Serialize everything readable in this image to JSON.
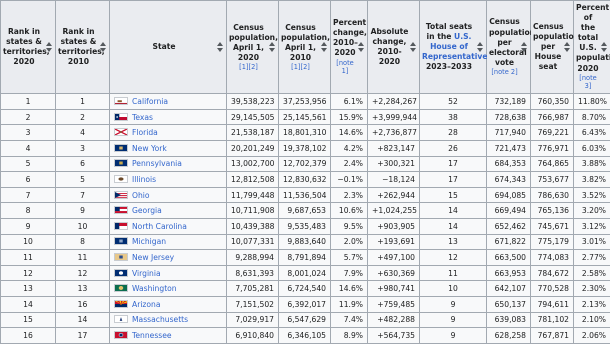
{
  "columns": [
    {
      "label": "Rank in states & territories, 2020"
    },
    {
      "label": "Rank in states & territories, 2010"
    },
    {
      "label": "State"
    },
    {
      "label": "Census population, April 1, 2020",
      "note": "[1][2]"
    },
    {
      "label": "Census population, April 1, 2010",
      "note": "[1][2]"
    },
    {
      "label": "Percent change, 2010–2020",
      "note": "[note 1]"
    },
    {
      "label": "Absolute change, 2010-2020"
    },
    {
      "label_pre": "Total seats in the ",
      "link": "U.S. House of Representatives",
      "label_post": ", 2023–2033"
    },
    {
      "label": "Census population per electoral vote",
      "note": "[note 2]"
    },
    {
      "label": "Census population per House seat"
    },
    {
      "label": "Percent of the total U.S. population, 2020",
      "note": "[note 3]"
    }
  ],
  "rows": [
    {
      "rank2020": "1",
      "rank2010": "1",
      "state": "California",
      "flag": "california-flag-icon",
      "pop2020": "39,538,223",
      "pop2010": "37,253,956",
      "pct_change": "6.1%",
      "abs_change": "+2,284,267",
      "seats": "52",
      "per_ev": "732,189",
      "per_seat": "760,350",
      "pct_total": "11.80%"
    },
    {
      "rank2020": "2",
      "rank2010": "2",
      "state": "Texas",
      "flag": "texas-flag-icon",
      "pop2020": "29,145,505",
      "pop2010": "25,145,561",
      "pct_change": "15.9%",
      "abs_change": "+3,999,944",
      "seats": "38",
      "per_ev": "728,638",
      "per_seat": "766,987",
      "pct_total": "8.70%"
    },
    {
      "rank2020": "3",
      "rank2010": "4",
      "state": "Florida",
      "flag": "florida-flag-icon",
      "pop2020": "21,538,187",
      "pop2010": "18,801,310",
      "pct_change": "14.6%",
      "abs_change": "+2,736,877",
      "seats": "28",
      "per_ev": "717,940",
      "per_seat": "769,221",
      "pct_total": "6.43%"
    },
    {
      "rank2020": "4",
      "rank2010": "3",
      "state": "New York",
      "flag": "new-york-flag-icon",
      "pop2020": "20,201,249",
      "pop2010": "19,378,102",
      "pct_change": "4.2%",
      "abs_change": "+823,147",
      "seats": "26",
      "per_ev": "721,473",
      "per_seat": "776,971",
      "pct_total": "6.03%"
    },
    {
      "rank2020": "5",
      "rank2010": "6",
      "state": "Pennsylvania",
      "flag": "pennsylvania-flag-icon",
      "pop2020": "13,002,700",
      "pop2010": "12,702,379",
      "pct_change": "2.4%",
      "abs_change": "+300,321",
      "seats": "17",
      "per_ev": "684,353",
      "per_seat": "764,865",
      "pct_total": "3.88%"
    },
    {
      "rank2020": "6",
      "rank2010": "5",
      "state": "Illinois",
      "flag": "illinois-flag-icon",
      "pop2020": "12,812,508",
      "pop2010": "12,830,632",
      "pct_change": "−0.1%",
      "abs_change": "−18,124",
      "seats": "17",
      "per_ev": "674,343",
      "per_seat": "753,677",
      "pct_total": "3.82%"
    },
    {
      "rank2020": "7",
      "rank2010": "7",
      "state": "Ohio",
      "flag": "ohio-flag-icon",
      "pop2020": "11,799,448",
      "pop2010": "11,536,504",
      "pct_change": "2.3%",
      "abs_change": "+262,944",
      "seats": "15",
      "per_ev": "694,085",
      "per_seat": "786,630",
      "pct_total": "3.52%"
    },
    {
      "rank2020": "8",
      "rank2010": "9",
      "state": "Georgia",
      "flag": "georgia-flag-icon",
      "pop2020": "10,711,908",
      "pop2010": "9,687,653",
      "pct_change": "10.6%",
      "abs_change": "+1,024,255",
      "seats": "14",
      "per_ev": "669,494",
      "per_seat": "765,136",
      "pct_total": "3.20%"
    },
    {
      "rank2020": "9",
      "rank2010": "10",
      "state": "North Carolina",
      "flag": "north-carolina-flag-icon",
      "pop2020": "10,439,388",
      "pop2010": "9,535,483",
      "pct_change": "9.5%",
      "abs_change": "+903,905",
      "seats": "14",
      "per_ev": "652,462",
      "per_seat": "745,671",
      "pct_total": "3.12%"
    },
    {
      "rank2020": "10",
      "rank2010": "8",
      "state": "Michigan",
      "flag": "michigan-flag-icon",
      "pop2020": "10,077,331",
      "pop2010": "9,883,640",
      "pct_change": "2.0%",
      "abs_change": "+193,691",
      "seats": "13",
      "per_ev": "671,822",
      "per_seat": "775,179",
      "pct_total": "3.01%"
    },
    {
      "rank2020": "11",
      "rank2010": "11",
      "state": "New Jersey",
      "flag": "new-jersey-flag-icon",
      "pop2020": "9,288,994",
      "pop2010": "8,791,894",
      "pct_change": "5.7%",
      "abs_change": "+497,100",
      "seats": "12",
      "per_ev": "663,500",
      "per_seat": "774,083",
      "pct_total": "2.77%"
    },
    {
      "rank2020": "12",
      "rank2010": "12",
      "state": "Virginia",
      "flag": "virginia-flag-icon",
      "pop2020": "8,631,393",
      "pop2010": "8,001,024",
      "pct_change": "7.9%",
      "abs_change": "+630,369",
      "seats": "11",
      "per_ev": "663,953",
      "per_seat": "784,672",
      "pct_total": "2.58%"
    },
    {
      "rank2020": "13",
      "rank2010": "13",
      "state": "Washington",
      "flag": "washington-flag-icon",
      "pop2020": "7,705,281",
      "pop2010": "6,724,540",
      "pct_change": "14.6%",
      "abs_change": "+980,741",
      "seats": "10",
      "per_ev": "642,107",
      "per_seat": "770,528",
      "pct_total": "2.30%"
    },
    {
      "rank2020": "14",
      "rank2010": "16",
      "state": "Arizona",
      "flag": "arizona-flag-icon",
      "pop2020": "7,151,502",
      "pop2010": "6,392,017",
      "pct_change": "11.9%",
      "abs_change": "+759,485",
      "seats": "9",
      "per_ev": "650,137",
      "per_seat": "794,611",
      "pct_total": "2.13%"
    },
    {
      "rank2020": "15",
      "rank2010": "14",
      "state": "Massachusetts",
      "flag": "massachusetts-flag-icon",
      "pop2020": "7,029,917",
      "pop2010": "6,547,629",
      "pct_change": "7.4%",
      "abs_change": "+482,288",
      "seats": "9",
      "per_ev": "639,083",
      "per_seat": "781,102",
      "pct_total": "2.10%"
    },
    {
      "rank2020": "16",
      "rank2010": "17",
      "state": "Tennessee",
      "flag": "tennessee-flag-icon",
      "pop2020": "6,910,840",
      "pop2010": "6,346,105",
      "pct_change": "8.9%",
      "abs_change": "+564,735",
      "seats": "9",
      "per_ev": "628,258",
      "per_seat": "767,871",
      "pct_total": "2.06%"
    }
  ]
}
